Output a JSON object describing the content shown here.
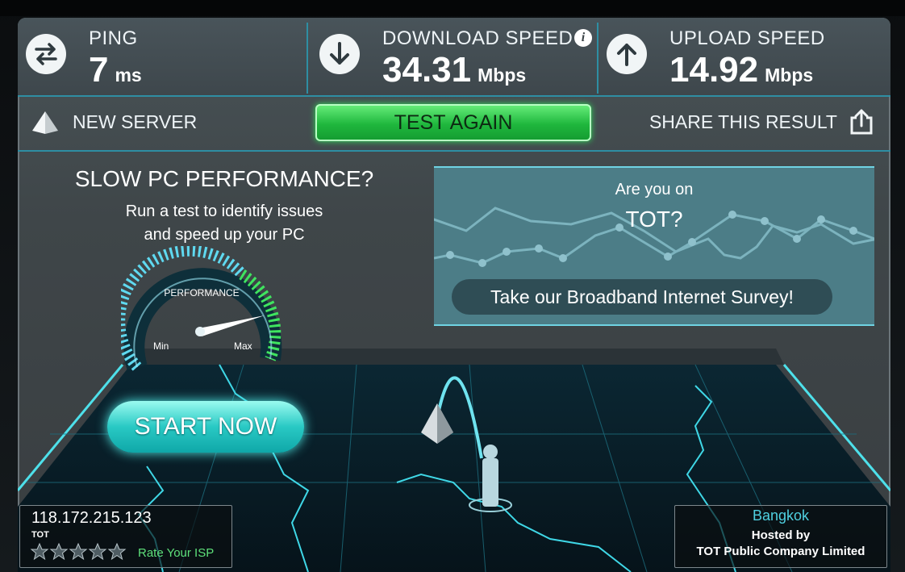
{
  "stats": {
    "ping": {
      "label": "PING",
      "value": "7",
      "unit": "ms",
      "icon": "ping-arrows-icon"
    },
    "download": {
      "label": "DOWNLOAD SPEED",
      "value": "34.31",
      "unit": "Mbps",
      "icon": "download-arrow-icon"
    },
    "upload": {
      "label": "UPLOAD SPEED",
      "value": "14.92",
      "unit": "Mbps",
      "icon": "upload-arrow-icon"
    }
  },
  "actions": {
    "new_server": "NEW SERVER",
    "test_again": "TEST AGAIN",
    "share": "SHARE THIS RESULT"
  },
  "ad": {
    "title": "SLOW PC PERFORMANCE?",
    "line1": "Run a test to identify issues",
    "line2": "and speed up your PC",
    "gauge_label": "PERFORMANCE",
    "gauge_min": "Min",
    "gauge_max": "Max",
    "start": "START NOW"
  },
  "survey": {
    "question": "Are you on",
    "isp": "TOT?",
    "button": "Take our Broadband Internet Survey!"
  },
  "footer": {
    "ip": "118.172.215.123",
    "isp": "TOT",
    "rate": "Rate Your ISP",
    "stars": 0,
    "city": "Bangkok",
    "hosted_by": "Hosted by",
    "host": "TOT Public Company Limited"
  },
  "colors": {
    "accent": "#2e8ea3",
    "test_again": "#1fb73d",
    "start_now": "#29c9c4",
    "city": "#4fd0e0",
    "rate": "#5ee07a"
  }
}
